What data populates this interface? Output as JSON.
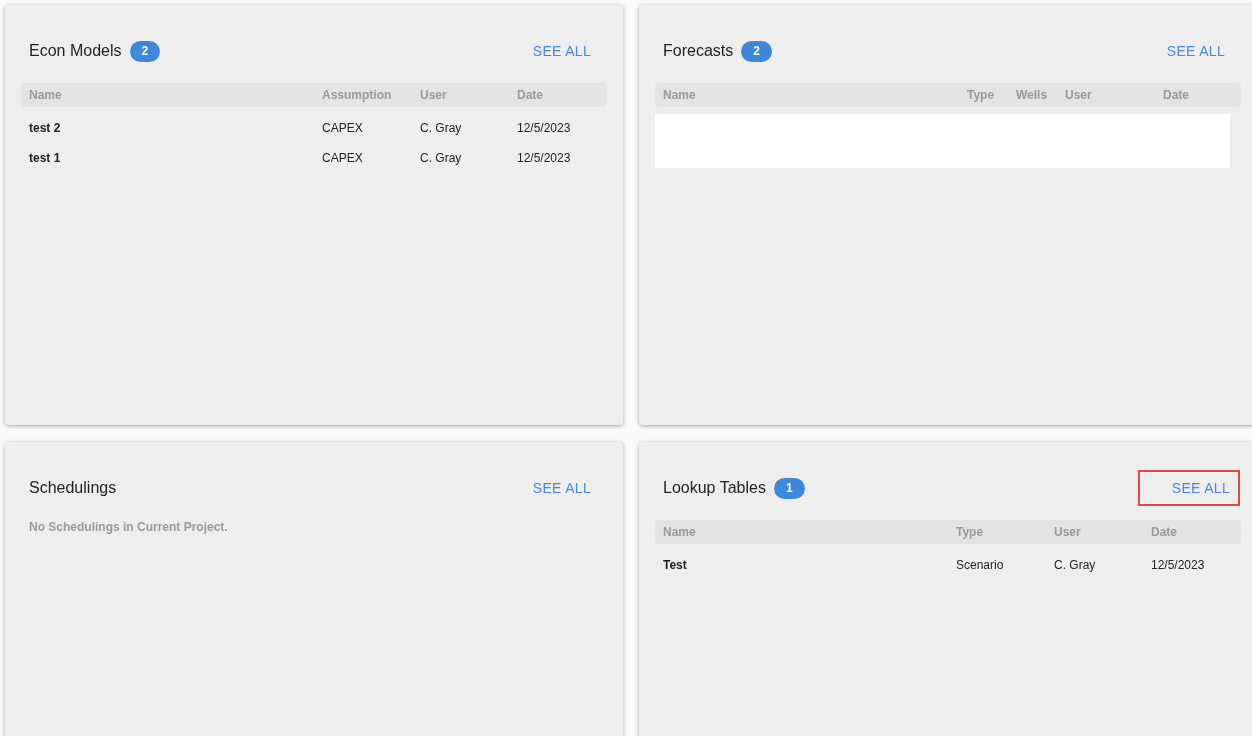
{
  "cards": [
    {
      "title": "Econ Models",
      "count": "2",
      "see_all": {
        "label": "SEE ALL",
        "highlighted": false
      },
      "columns": [
        "Name",
        "Assumption",
        "User",
        "Date"
      ],
      "rows": [
        [
          "test 2",
          "CAPEX",
          "C. Gray",
          "12/5/2023"
        ],
        [
          "test 1",
          "CAPEX",
          "C. Gray",
          "12/5/2023"
        ]
      ]
    },
    {
      "title": "Forecasts",
      "count": "2",
      "see_all": {
        "label": "SEE ALL",
        "highlighted": false
      },
      "columns": [
        "Name",
        "Type",
        "Wells",
        "User",
        "Date"
      ],
      "blank_body": true
    },
    {
      "title": "Schedulings",
      "see_all": {
        "label": "SEE ALL",
        "highlighted": false
      },
      "empty_message": "No Schedulings in Current Project."
    },
    {
      "title": "Lookup Tables",
      "count": "1",
      "see_all": {
        "label": "SEE ALL",
        "highlighted": true
      },
      "columns": [
        "Name",
        "Type",
        "User",
        "Date"
      ],
      "rows": [
        [
          "Test",
          "Scenario",
          "C. Gray",
          "12/5/2023"
        ]
      ]
    }
  ]
}
